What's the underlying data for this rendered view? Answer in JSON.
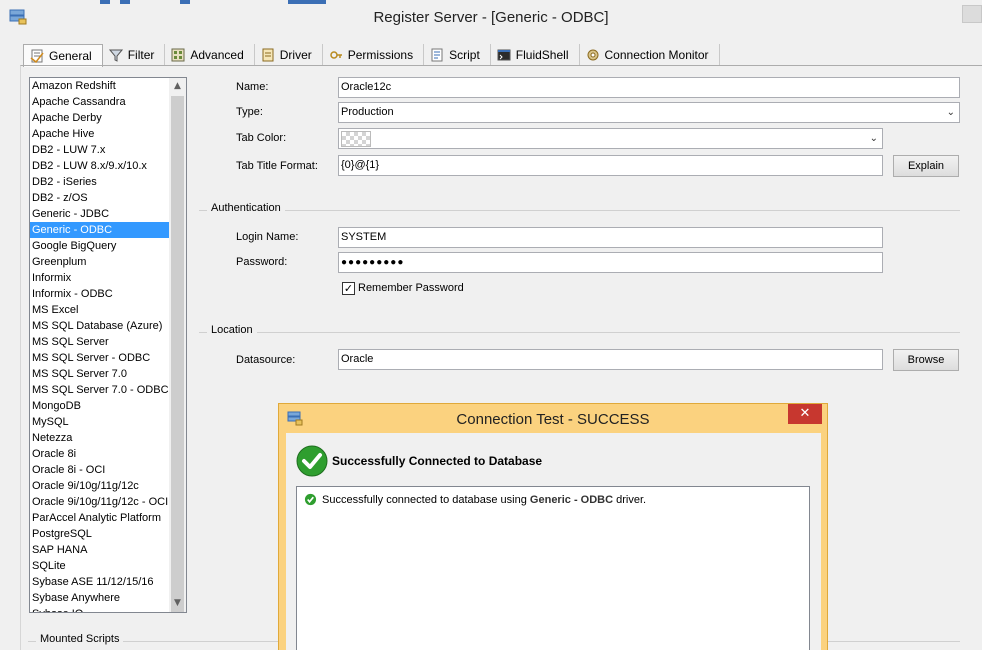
{
  "window": {
    "title": "Register Server - [Generic - ODBC]"
  },
  "tabs": [
    {
      "label": "General",
      "icon": "general-icon"
    },
    {
      "label": "Filter",
      "icon": "filter-icon"
    },
    {
      "label": "Advanced",
      "icon": "advanced-icon"
    },
    {
      "label": "Driver",
      "icon": "driver-icon"
    },
    {
      "label": "Permissions",
      "icon": "permissions-icon"
    },
    {
      "label": "Script",
      "icon": "script-icon"
    },
    {
      "label": "FluidShell",
      "icon": "fluidshell-icon"
    },
    {
      "label": "Connection Monitor",
      "icon": "connection-monitor-icon"
    }
  ],
  "database_types": {
    "selected": "Generic - ODBC",
    "items": [
      "Amazon Redshift",
      "Apache Cassandra",
      "Apache Derby",
      "Apache Hive",
      "DB2 - LUW 7.x",
      "DB2 - LUW 8.x/9.x/10.x",
      "DB2 - iSeries",
      "DB2 - z/OS",
      "Generic - JDBC",
      "Generic - ODBC",
      "Google BigQuery",
      "Greenplum",
      "Informix",
      "Informix - ODBC",
      "MS Excel",
      "MS SQL Database (Azure)",
      "MS SQL Server",
      "MS SQL Server - ODBC",
      "MS SQL Server 7.0",
      "MS SQL Server 7.0 - ODBC",
      "MongoDB",
      "MySQL",
      "Netezza",
      "Oracle 8i",
      "Oracle 8i - OCI",
      "Oracle 9i/10g/11g/12c",
      "Oracle 9i/10g/11g/12c - OCI",
      "ParAccel Analytic Platform",
      "PostgreSQL",
      "SAP HANA",
      "SQLite",
      "Sybase ASE 11/12/15/16",
      "Sybase Anywhere",
      "Sybase IQ"
    ]
  },
  "form": {
    "name_label": "Name:",
    "name_value": "Oracle12c",
    "type_label": "Type:",
    "type_value": "Production",
    "tab_color_label": "Tab Color:",
    "tab_title_label": "Tab Title Format:",
    "tab_title_value": "{0}@{1}",
    "explain_button": "Explain",
    "auth_section": "Authentication",
    "login_label": "Login Name:",
    "login_value": "SYSTEM",
    "password_label": "Password:",
    "password_value": "●●●●●●●●●",
    "remember_label": "Remember Password",
    "remember_checked": true,
    "location_section": "Location",
    "datasource_label": "Datasource:",
    "datasource_value": "Oracle",
    "browse_button": "Browse",
    "mounted_section": "Mounted Scripts"
  },
  "dialog": {
    "title": "Connection Test - SUCCESS",
    "close_glyph": "✕",
    "heading": "Successfully Connected to Database",
    "message_prefix": "Successfully connected to database using ",
    "message_driver": "Generic - ODBC",
    "message_suffix": " driver."
  },
  "colors": {
    "accent": "#3399ff",
    "dialog_frame": "#fbd27f",
    "close_red": "#c7372f",
    "success_green": "#2f9e2f"
  }
}
